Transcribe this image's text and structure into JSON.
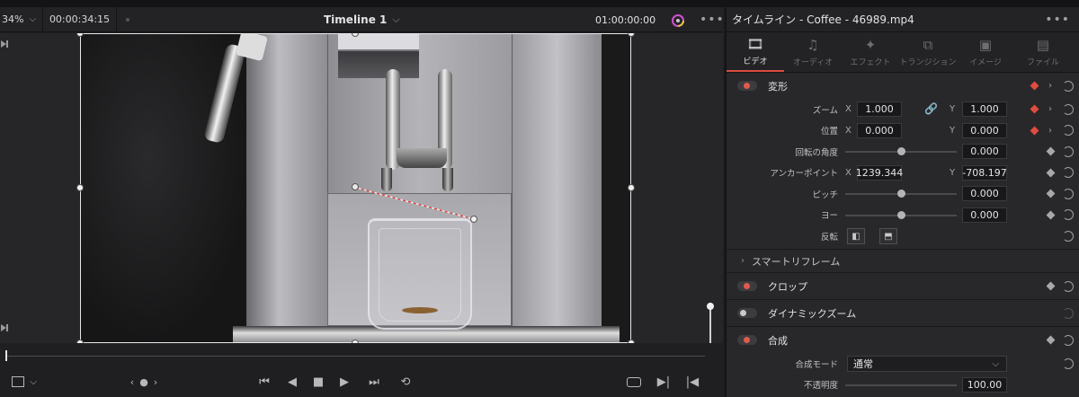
{
  "viewer": {
    "zoom": "34%",
    "source_timecode": "00:00:34:15",
    "timeline_name": "Timeline 1",
    "record_timecode": "01:00:00:00"
  },
  "inspector": {
    "title": "タイムライン - Coffee - 46989.mp4",
    "tabs": [
      {
        "label": "ビデオ",
        "icon": "film-icon"
      },
      {
        "label": "オーディオ",
        "icon": "music-note-icon"
      },
      {
        "label": "エフェクト",
        "icon": "magic-wand-icon"
      },
      {
        "label": "トランジション",
        "icon": "transition-icon"
      },
      {
        "label": "イメージ",
        "icon": "image-icon"
      },
      {
        "label": "ファイル",
        "icon": "file-icon"
      }
    ],
    "transform": {
      "label": "変形",
      "zoom": {
        "label": "ズーム",
        "x_axis": "X",
        "x": "1.000",
        "y_axis": "Y",
        "y": "1.000"
      },
      "position": {
        "label": "位置",
        "x_axis": "X",
        "x": "0.000",
        "y_axis": "Y",
        "y": "0.000"
      },
      "rotation": {
        "label": "回転の角度",
        "value": "0.000",
        "slider": 0.5
      },
      "anchor": {
        "label": "アンカーポイント",
        "x_axis": "X",
        "x": "1239.344",
        "y_axis": "Y",
        "y": "-708.197"
      },
      "pitch": {
        "label": "ピッチ",
        "value": "0.000",
        "slider": 0.5
      },
      "yaw": {
        "label": "ヨー",
        "value": "0.000",
        "slider": 0.5
      },
      "flip": {
        "label": "反転"
      }
    },
    "smart_reframe": {
      "label": "スマートリフレーム"
    },
    "crop": {
      "label": "クロップ"
    },
    "dynamic_zoom": {
      "label": "ダイナミックズーム"
    },
    "composite": {
      "label": "合成",
      "mode_label": "合成モード",
      "mode_value": "通常",
      "opacity_label": "不透明度",
      "opacity_value": "100.00"
    }
  },
  "colors": {
    "accent_red": "#e04c3e",
    "panel_bg": "#28282b"
  }
}
